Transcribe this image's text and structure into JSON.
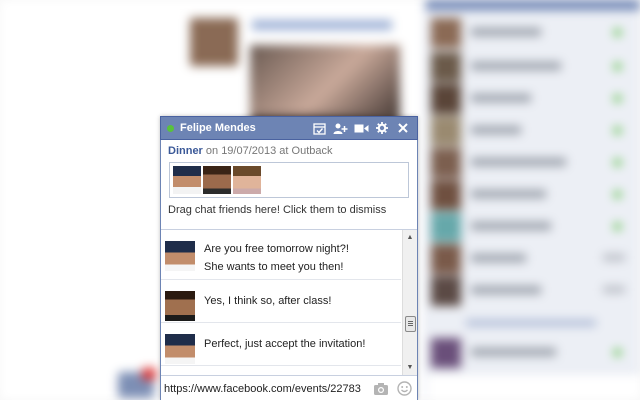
{
  "chat": {
    "name": "Felipe Mendes",
    "status_color": "#58c23c",
    "header_icons": [
      "add-to-event-icon",
      "add-friends-icon",
      "video-call-icon",
      "gear-icon",
      "close-icon"
    ],
    "event": {
      "title": "Dinner",
      "details": " on 19/07/2013 at Outback"
    },
    "drag_hint": "Drag chat friends here! Click them to dismiss",
    "messages": [
      {
        "avatar": "felipe",
        "text_lines": [
          "Are you free tomorrow night?!",
          "She wants to meet you then!"
        ]
      },
      {
        "avatar": "friend",
        "text_lines": [
          "Yes, I think so, after class!"
        ]
      },
      {
        "avatar": "felipe",
        "text_lines": [
          "Perfect, just accept the invitation!"
        ]
      }
    ],
    "input_value": "https://www.facebook.com/events/22783",
    "input_icons": [
      "camera-icon",
      "emoticon-icon"
    ]
  },
  "colors": {
    "header_bg": "#6d84b4",
    "link": "#3b5998"
  }
}
